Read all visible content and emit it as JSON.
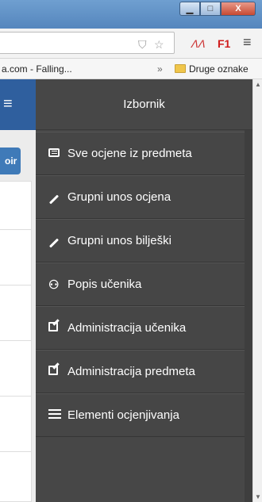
{
  "window": {
    "minimize_label": "▁",
    "maximize_label": "□",
    "close_label": "X"
  },
  "toolbar": {
    "f1_label": "F1",
    "menu_glyph": "≡",
    "star_glyph": "☆"
  },
  "bookmarks": {
    "left_item": "a.com - Falling...",
    "overflow": "»",
    "folder_label": "Druge oznake"
  },
  "left_page": {
    "button_fragment": "oir"
  },
  "menu": {
    "title": "Izbornik",
    "items": [
      {
        "label": "Sve ocjene iz predmeta",
        "icon": "list-alt-icon"
      },
      {
        "label": "Grupni unos ocjena",
        "icon": "pencil-icon"
      },
      {
        "label": "Grupni unos bilješki",
        "icon": "pencil-icon"
      },
      {
        "label": "Popis učenika",
        "icon": "users-icon"
      },
      {
        "label": "Administracija učenika",
        "icon": "edit-icon"
      },
      {
        "label": "Administracija predmeta",
        "icon": "edit-icon"
      },
      {
        "label": "Elementi ocjenjivanja",
        "icon": "list-icon"
      }
    ]
  }
}
